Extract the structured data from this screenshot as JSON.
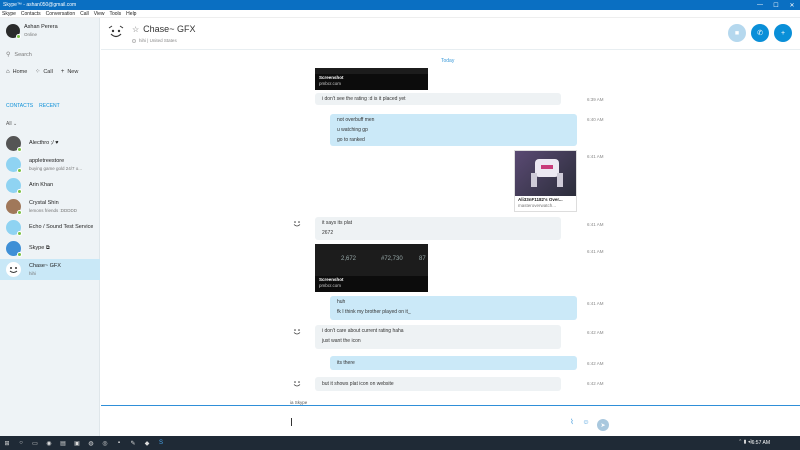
{
  "window": {
    "title": "Skype™ - ashan050@gmail.com"
  },
  "menu": [
    "Skype",
    "Contacts",
    "Conversation",
    "Call",
    "View",
    "Tools",
    "Help"
  ],
  "profile": {
    "name": "Ashan Perera",
    "status": "Online"
  },
  "search": {
    "placeholder": "Search",
    "icon": "search-icon"
  },
  "nav": {
    "home": "Home",
    "call": "Call",
    "new": "New"
  },
  "tabs": {
    "contacts": "CONTACTS",
    "recent": "RECENT"
  },
  "filter": "All",
  "contacts": [
    {
      "name": "Alecthro ;/ ♥",
      "mood": "",
      "color": "#555"
    },
    {
      "name": "appletreestore",
      "mood": "buying game gold 24/7 o...",
      "color": "#8fd3f2"
    },
    {
      "name": "Arin Khan",
      "mood": "",
      "color": "#8fd3f2"
    },
    {
      "name": "Crystal Shin",
      "mood": "lemons friends :DDDDD",
      "color": "#a0785a"
    },
    {
      "name": "Echo / Sound Test Service",
      "mood": "",
      "color": "#8fd3f2"
    },
    {
      "name": "Skype ⧉",
      "mood": "",
      "color": "#3e8fd6"
    },
    {
      "name": "Chase~ GFX",
      "mood": "hihi",
      "color": "#ffffff"
    }
  ],
  "header": {
    "name": "Chase~ GFX",
    "location": "hihi | United States"
  },
  "chat": {
    "today": "Today",
    "card1": {
      "title": "Screenshot",
      "source": "pmbcr.com"
    },
    "msg1": "i don't see the rating :d is it placed yet",
    "time1": "6:39 AM",
    "out1": [
      "not overbuff men",
      "u watching gp",
      "go to ranked"
    ],
    "time2": "6:40 AM",
    "time3": "6:41 AM",
    "owcard": {
      "title": "Ali33nF1182's Over...",
      "source": "masteroverwatch..."
    },
    "msg2": [
      "it says its plat",
      "2672"
    ],
    "time4": "6:41 AM",
    "time5": "6:41 AM",
    "card2": {
      "title": "Screenshot",
      "source": "pmbcr.com",
      "stat1": "2,672",
      "stat2": "#72,730",
      "stat3": "87"
    },
    "out2": [
      "huh",
      "fk I think my brother played on it_"
    ],
    "time6": "6:41 AM",
    "msg3": [
      "i don't care about current rating haha",
      "just want the icon"
    ],
    "time7": "6:42 AM",
    "out3": "its there",
    "time8": "6:42 AM",
    "msg4": "but it shows plat icon on website",
    "time9": "6:42 AM"
  },
  "composer": {
    "label": "ia Skype"
  },
  "taskbar": {
    "time": "6:57 AM"
  }
}
